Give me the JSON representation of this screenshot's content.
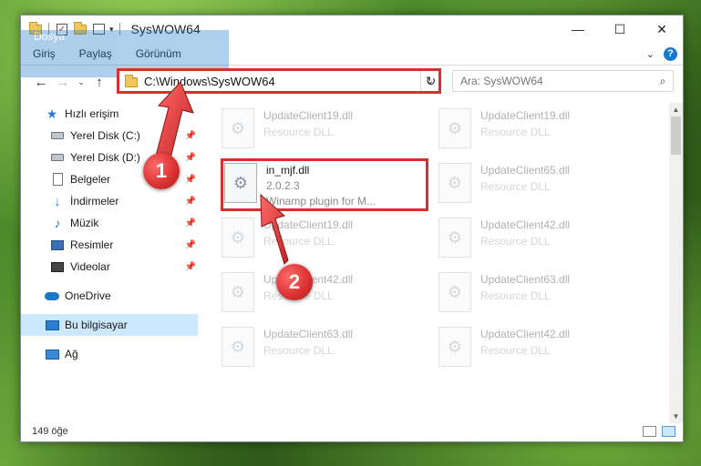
{
  "window": {
    "title": "SysWOW64",
    "controls": {
      "minimize": "—",
      "maximize": "☐",
      "close": "✕"
    }
  },
  "ribbon": {
    "tabs": [
      "Dosya",
      "Giriş",
      "Paylaş",
      "Görünüm"
    ],
    "help": "?"
  },
  "nav": {
    "back": "←",
    "forward": "→",
    "recent": "⌄",
    "up": "↑"
  },
  "address": {
    "path": "C:\\Windows\\SysWOW64",
    "refresh": "↻"
  },
  "search": {
    "placeholder": "Ara: SysWOW64"
  },
  "sidebar": {
    "items": [
      {
        "label": "Hızlı erişim",
        "icon": "star-icon"
      },
      {
        "label": "Yerel Disk (C:)",
        "icon": "disk-icon",
        "pinned": true
      },
      {
        "label": "Yerel Disk (D:)",
        "icon": "disk-icon",
        "pinned": true
      },
      {
        "label": "Belgeler",
        "icon": "documents-icon",
        "pinned": true
      },
      {
        "label": "İndirmeler",
        "icon": "download-icon",
        "pinned": true
      },
      {
        "label": "Müzik",
        "icon": "music-icon",
        "pinned": true
      },
      {
        "label": "Resimler",
        "icon": "pictures-icon",
        "pinned": true
      },
      {
        "label": "Videolar",
        "icon": "videos-icon",
        "pinned": true
      },
      {
        "label": "OneDrive",
        "icon": "onedrive-icon"
      },
      {
        "label": "Bu bilgisayar",
        "icon": "computer-icon",
        "selected": true
      },
      {
        "label": "Ağ",
        "icon": "network-icon"
      }
    ]
  },
  "files": [
    {
      "name": "UpdateClient19.dll",
      "sub": "Resource DLL"
    },
    {
      "name": "UpdateClient19.dll",
      "sub": "Resource DLL"
    },
    {
      "name": "in_mjf.dll",
      "sub": "2.0.2.3",
      "desc": "Winamp plugin for M..."
    },
    {
      "name": "UpdateClient65.dll",
      "sub": "Resource DLL"
    },
    {
      "name": "UpdateClient19.dll",
      "sub": "Resource DLL"
    },
    {
      "name": "UpdateClient42.dll",
      "sub": "Resource DLL"
    },
    {
      "name": "UpdateClient42.dll",
      "sub": "Resource DLL"
    },
    {
      "name": "UpdateClient63.dll",
      "sub": "Resource DLL"
    },
    {
      "name": "UpdateClient63.dll",
      "sub": "Resource DLL"
    },
    {
      "name": "UpdateClient42.dll",
      "sub": "Resource DLL"
    }
  ],
  "status": {
    "count": "149 öğe"
  },
  "annotations": {
    "step1": "1",
    "step2": "2"
  },
  "colors": {
    "accent": "#1979ca",
    "highlight": "#d92f2f",
    "selection": "#cce8ff"
  }
}
